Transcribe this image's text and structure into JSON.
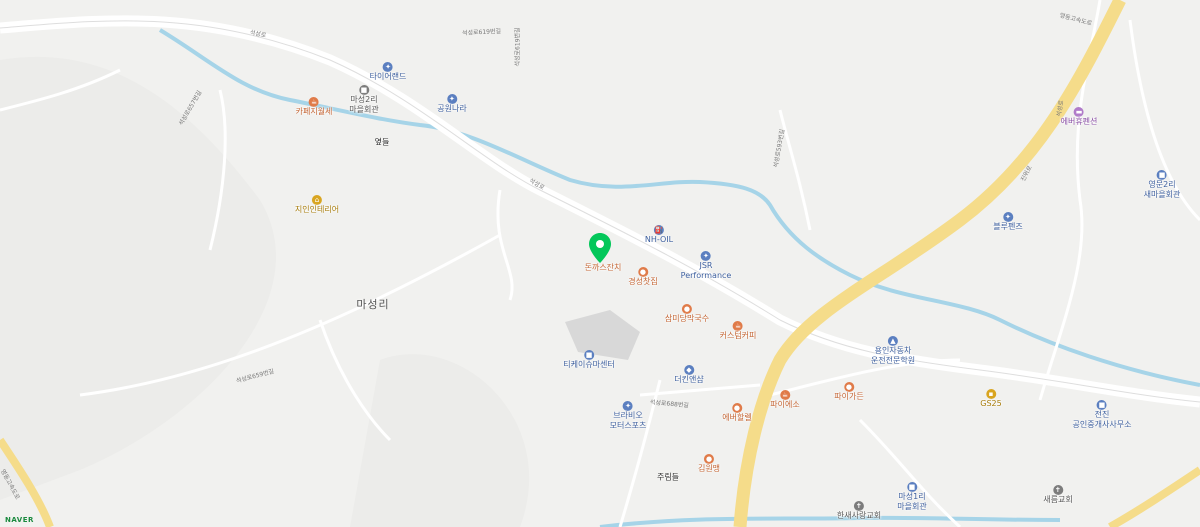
{
  "map": {
    "attribution": "NAVER",
    "colors": {
      "background": "#f1f1ef",
      "road": "#ffffff",
      "highway": "#f5dc8a",
      "river": "#a6d4e8",
      "marker": "#03c75a",
      "building": "#d8d8d8"
    },
    "selected_place": {
      "name": "돈까스잔치",
      "category_color": "orange"
    },
    "pois": [
      {
        "key": "tire",
        "name": "타이어랜드",
        "icon": "wrench-icon",
        "color": "blue"
      },
      {
        "key": "hall2",
        "name": "마성2리\n마을회관",
        "icon": "building-icon",
        "color": "gray"
      },
      {
        "key": "cafe",
        "name": "카페지월세",
        "icon": "cafe-icon",
        "color": "orange"
      },
      {
        "key": "factory",
        "name": "공원나라",
        "icon": "wrench-icon",
        "color": "blue"
      },
      {
        "key": "interior",
        "name": "지인인테리어",
        "icon": "home-icon",
        "color": "yellow"
      },
      {
        "key": "nhoil",
        "name": "NH-OIL",
        "icon": "fuel-icon",
        "color": "blue"
      },
      {
        "key": "jsr",
        "name": "JSR\nPerformance",
        "icon": "wrench-icon",
        "color": "blue"
      },
      {
        "key": "gyeongsung",
        "name": "경성찻집",
        "icon": "food-icon",
        "color": "orange"
      },
      {
        "key": "noodle",
        "name": "삼미당막국수",
        "icon": "food-icon",
        "color": "orange"
      },
      {
        "key": "custom",
        "name": "커스텀커피",
        "icon": "cafe-icon",
        "color": "orange"
      },
      {
        "key": "tk",
        "name": "티케이슈마센터",
        "icon": "building-icon",
        "color": "blue"
      },
      {
        "key": "theking",
        "name": "더킨앤샵",
        "icon": "shop-icon",
        "color": "blue"
      },
      {
        "key": "brabio",
        "name": "브라비오\n모터스포츠",
        "icon": "wrench-icon",
        "color": "blue"
      },
      {
        "key": "evermal",
        "name": "에버할렐",
        "icon": "food-icon",
        "color": "orange"
      },
      {
        "key": "pineso",
        "name": "파이에소",
        "icon": "cafe-icon",
        "color": "orange"
      },
      {
        "key": "pipigen",
        "name": "파이가든",
        "icon": "food-icon",
        "color": "orange"
      },
      {
        "key": "gimbab",
        "name": "김원맹",
        "icon": "food-icon",
        "color": "orange"
      },
      {
        "key": "driving",
        "name": "용인자동차\n운전전문학원",
        "icon": "school-icon",
        "color": "blue"
      },
      {
        "key": "gs25",
        "name": "GS25",
        "icon": "store-icon",
        "color": "yellow"
      },
      {
        "key": "realestate",
        "name": "전진\n공인중개사사무소",
        "icon": "office-icon",
        "color": "blue"
      },
      {
        "key": "church1",
        "name": "새름교회",
        "icon": "church-icon",
        "color": "gray"
      },
      {
        "key": "church2",
        "name": "한새사랑교회",
        "icon": "church-icon",
        "color": "gray"
      },
      {
        "key": "hall1",
        "name": "마성1리\n마을회관",
        "icon": "building-icon",
        "color": "blue"
      },
      {
        "key": "everpension",
        "name": "에버휴펜션",
        "icon": "bed-icon",
        "color": "purple"
      },
      {
        "key": "yeongmun",
        "name": "영문2리\n새마을회관",
        "icon": "building-icon",
        "color": "blue"
      },
      {
        "key": "blue",
        "name": "블루펜즈",
        "icon": "wrench-icon",
        "color": "blue"
      }
    ],
    "places": [
      {
        "key": "yeoldeul",
        "name": "옆들"
      },
      {
        "key": "jurimdeul",
        "name": "주림들"
      }
    ],
    "area_label": "마성리",
    "road_labels": [
      {
        "key": "r1",
        "name": "석성로"
      },
      {
        "key": "r2",
        "name": "석성로"
      },
      {
        "key": "r3",
        "name": "석성로619번길"
      },
      {
        "key": "r4",
        "name": "석성로619번길"
      },
      {
        "key": "r5",
        "name": "석성로593번길"
      },
      {
        "key": "r6",
        "name": "석성로657번길"
      },
      {
        "key": "r7",
        "name": "석성로659번길"
      },
      {
        "key": "r8",
        "name": "석성로688번길"
      },
      {
        "key": "r9",
        "name": "영동고속도로"
      },
      {
        "key": "r10",
        "name": "진위로"
      },
      {
        "key": "r11",
        "name": "석성로"
      },
      {
        "key": "r12",
        "name": "영동고속도로"
      }
    ]
  }
}
